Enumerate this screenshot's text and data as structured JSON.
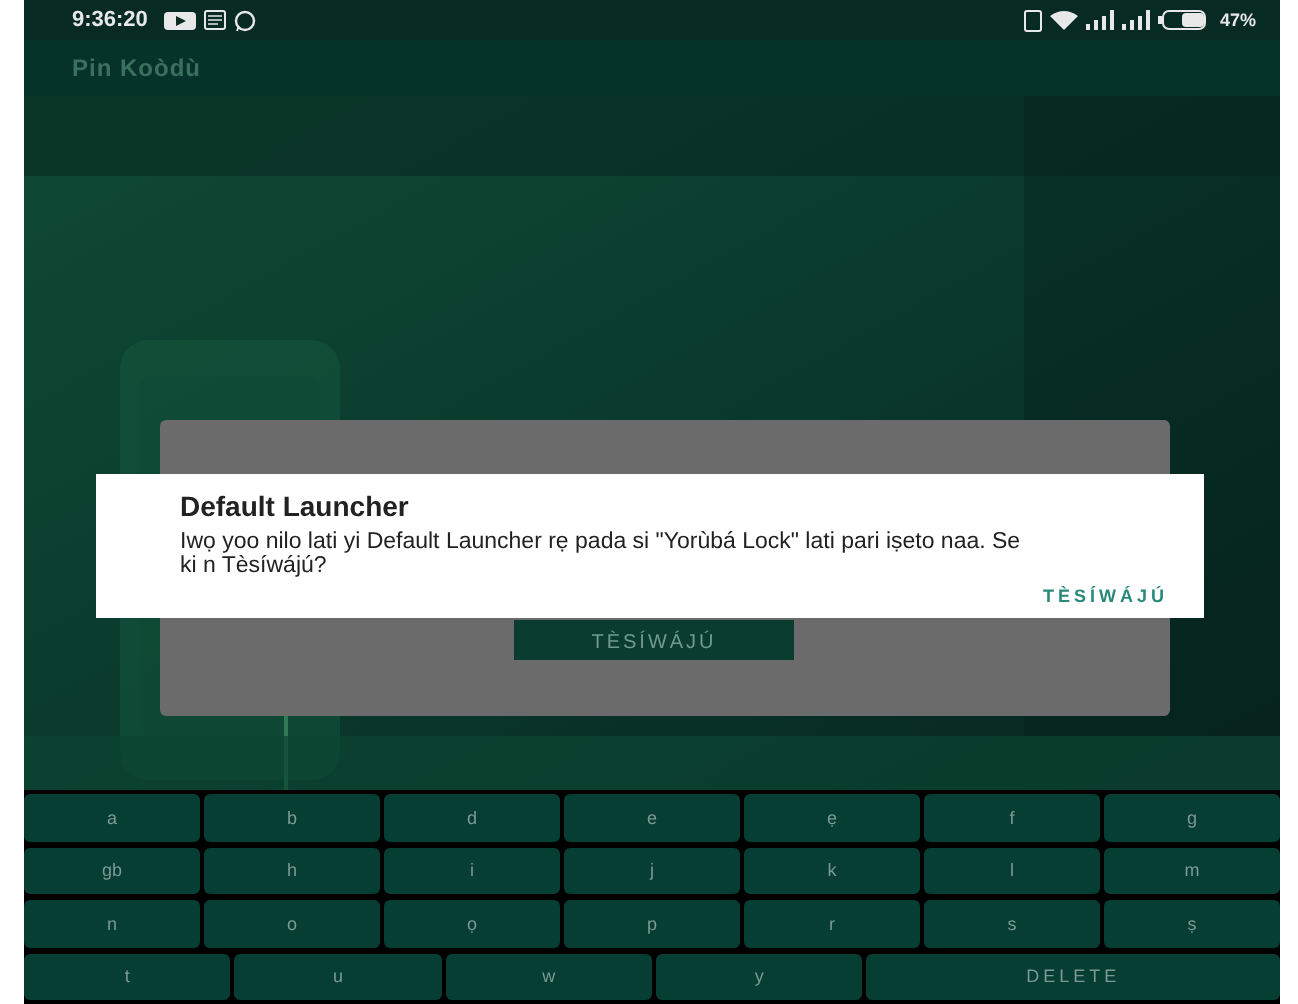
{
  "status_bar": {
    "time": "9:36:20",
    "battery": "47%"
  },
  "app_bar": {
    "title": "Pin Koòdù"
  },
  "background_dialog": {
    "button": "TÈSÍWÁJÚ"
  },
  "dialog": {
    "title": "Default Launcher",
    "message": "Iwọ yoo nilo lati yi Default Launcher rẹ pada si \"Yorùbá Lock\" lati pari iṣeto naa. Se ki n Tèsíwájú?",
    "button": "TÈSÍWÁJÚ"
  },
  "keyboard": {
    "rows": [
      {
        "keys": [
          {
            "label": "a",
            "kind": "letter"
          },
          {
            "label": "b",
            "kind": "letter"
          },
          {
            "label": "d",
            "kind": "letter"
          },
          {
            "label": "e",
            "kind": "letter"
          },
          {
            "label": "ẹ",
            "kind": "letter"
          },
          {
            "label": "f",
            "kind": "letter"
          },
          {
            "label": "g",
            "kind": "letter"
          }
        ]
      },
      {
        "keys": [
          {
            "label": "gb",
            "kind": "letter"
          },
          {
            "label": "h",
            "kind": "letter"
          },
          {
            "label": "i",
            "kind": "letter"
          },
          {
            "label": "j",
            "kind": "letter"
          },
          {
            "label": "k",
            "kind": "letter"
          },
          {
            "label": "l",
            "kind": "letter"
          },
          {
            "label": "m",
            "kind": "letter"
          }
        ]
      },
      {
        "keys": [
          {
            "label": "n",
            "kind": "letter"
          },
          {
            "label": "o",
            "kind": "letter"
          },
          {
            "label": "ọ",
            "kind": "letter"
          },
          {
            "label": "p",
            "kind": "letter"
          },
          {
            "label": "r",
            "kind": "letter"
          },
          {
            "label": "s",
            "kind": "letter"
          },
          {
            "label": "ṣ",
            "kind": "letter"
          }
        ]
      },
      {
        "keys": [
          {
            "label": "t",
            "kind": "letter"
          },
          {
            "label": "u",
            "kind": "letter"
          },
          {
            "label": "w",
            "kind": "letter"
          },
          {
            "label": "y",
            "kind": "letter"
          },
          {
            "label": "DELETE",
            "kind": "delete"
          }
        ]
      }
    ]
  }
}
